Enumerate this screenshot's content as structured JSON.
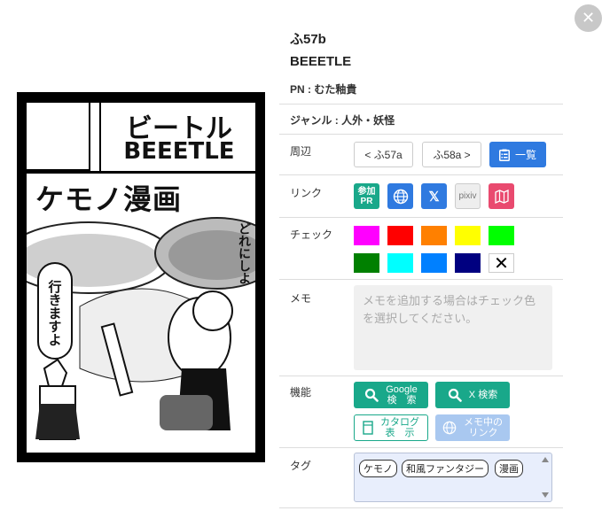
{
  "close": {
    "label": "✕"
  },
  "cut": {
    "title_jp": "ビートル",
    "title_en": "BEEETLE",
    "headline": "ケモノ漫画",
    "bubble_left": "行きますよ",
    "bubble_right": "どれにしよ"
  },
  "circle": {
    "space": "ふ57b",
    "name": "BEEETLE",
    "pn": "PN : むた釉貴",
    "genre": "ジャンル : 人外・妖怪"
  },
  "rows": {
    "nearby": "周辺",
    "link": "リンク",
    "check": "チェック",
    "memo": "メモ",
    "function": "機能",
    "tag": "タグ"
  },
  "nearby": {
    "prev": "< ふ57a",
    "next": "ふ58a >",
    "list": "一覧"
  },
  "links": {
    "sanka_line1": "参加",
    "sanka_line2": "PR",
    "x": "𝕏",
    "pixiv": "pixiv",
    "icons": [
      "globe-icon",
      "x-logo-icon",
      "map-icon"
    ]
  },
  "check_colors": [
    "#ff00ff",
    "#ff0000",
    "#ff8000",
    "#ffff00",
    "#00ff00",
    "#008000",
    "#00ffff",
    "#0080ff",
    "#000080"
  ],
  "check_clear": "✕",
  "memo": {
    "placeholder": "メモを追加する場合はチェック色を選択してください。"
  },
  "functions": {
    "google_line1": "Google",
    "google_line2": "検　索",
    "x_search": "X 検索",
    "catalog_line1": "カタログ",
    "catalog_line2": "表　示",
    "memo_link_line1": "メモ中の",
    "memo_link_line2": "リンク"
  },
  "tags": [
    "ケモノ",
    "和風ファンタジー",
    "漫画"
  ]
}
